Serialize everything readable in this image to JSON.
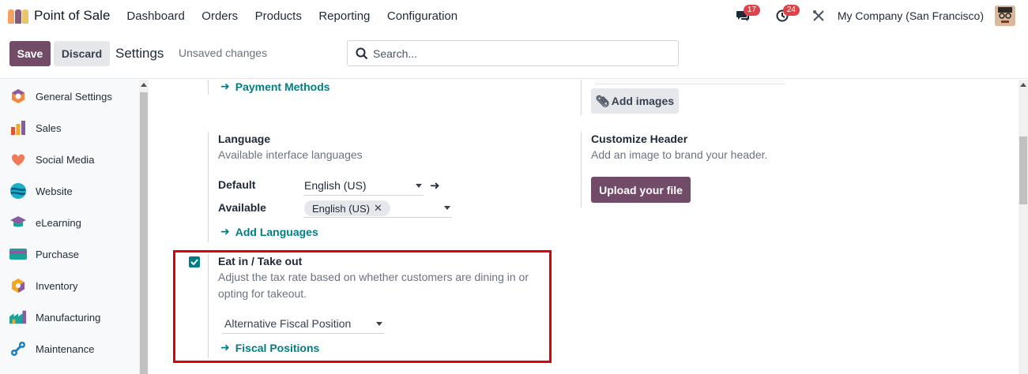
{
  "navbar": {
    "app_name": "Point of Sale",
    "menu": [
      "Dashboard",
      "Orders",
      "Products",
      "Reporting",
      "Configuration"
    ],
    "messages_count": "17",
    "activities_count": "24",
    "company": "My Company (San Francisco)"
  },
  "control": {
    "save_label": "Save",
    "discard_label": "Discard",
    "title": "Settings",
    "status": "Unsaved changes",
    "search_placeholder": "Search..."
  },
  "sidebar": {
    "items": [
      {
        "label": "General Settings",
        "icon": "general-settings-icon"
      },
      {
        "label": "Sales",
        "icon": "sales-icon"
      },
      {
        "label": "Social Media",
        "icon": "social-media-icon"
      },
      {
        "label": "Website",
        "icon": "website-icon"
      },
      {
        "label": "eLearning",
        "icon": "elearning-icon"
      },
      {
        "label": "Purchase",
        "icon": "purchase-icon"
      },
      {
        "label": "Inventory",
        "icon": "inventory-icon"
      },
      {
        "label": "Manufacturing",
        "icon": "manufacturing-icon"
      },
      {
        "label": "Maintenance",
        "icon": "maintenance-icon"
      }
    ]
  },
  "content": {
    "payment_methods_link": "Payment Methods",
    "add_images_label": "Add images",
    "language": {
      "title": "Language",
      "description": "Available interface languages",
      "default_label": "Default",
      "default_value": "English (US)",
      "available_label": "Available",
      "available_tag": "English (US)",
      "add_languages_link": "Add Languages"
    },
    "customize_header": {
      "title": "Customize Header",
      "description": "Add an image to brand your header.",
      "upload_label": "Upload your file"
    },
    "eat_in": {
      "title": "Eat in / Take out",
      "description_line1": "Adjust the tax rate based on whether customers are dining in or",
      "description_line2": "opting for takeout.",
      "checked": true,
      "fiscal_position_value": "Alternative Fiscal Position",
      "fiscal_positions_link": "Fiscal Positions"
    }
  },
  "colors": {
    "primary": "#714b67",
    "link": "#017e84",
    "highlight": "#e0000a"
  }
}
